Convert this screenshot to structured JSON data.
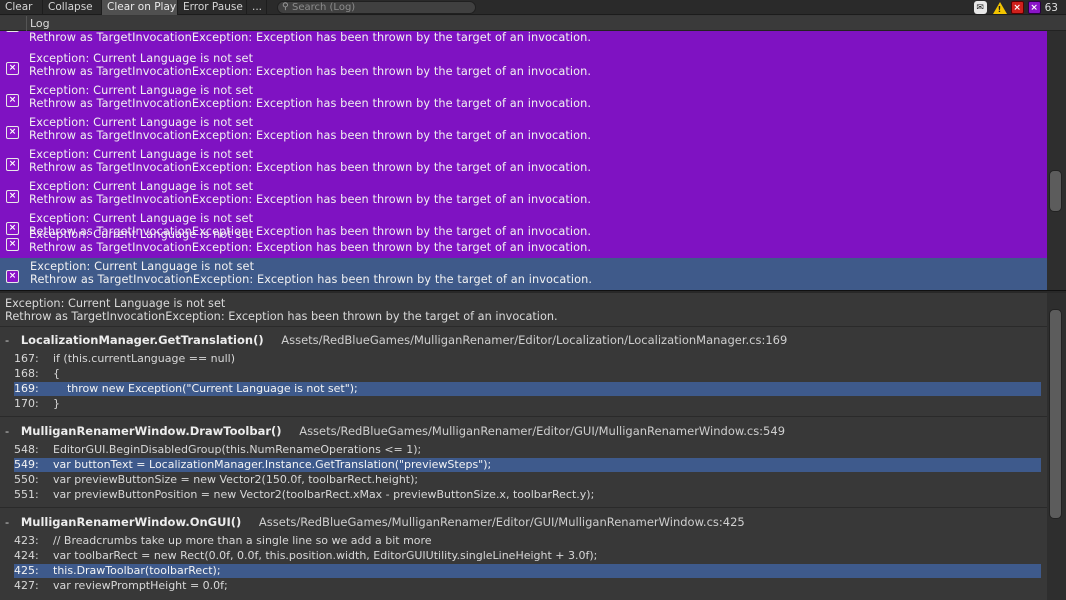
{
  "toolbar": {
    "buttons": [
      "Clear",
      "Collapse",
      "Clear on Play",
      "Error Pause",
      "..."
    ],
    "search_placeholder": "Search (Log)",
    "counts": {
      "exceptions": "63"
    }
  },
  "log_header": "Log",
  "log_entries": [
    {
      "line1": "",
      "line2": "Rethrow as TargetInvocationException: Exception has been thrown by the target of an invocation."
    },
    {
      "line1": "Exception: Current Language is not set",
      "line2": "Rethrow as TargetInvocationException: Exception has been thrown by the target of an invocation."
    },
    {
      "line1": "Exception: Current Language is not set",
      "line2": "Rethrow as TargetInvocationException: Exception has been thrown by the target of an invocation."
    },
    {
      "line1": "Exception: Current Language is not set",
      "line2": "Rethrow as TargetInvocationException: Exception has been thrown by the target of an invocation."
    },
    {
      "line1": "Exception: Current Language is not set",
      "line2": "Rethrow as TargetInvocationException: Exception has been thrown by the target of an invocation."
    },
    {
      "line1": "Exception: Current Language is not set",
      "line2": "Rethrow as TargetInvocationException: Exception has been thrown by the target of an invocation."
    },
    {
      "line1": "Exception: Current Language is not set",
      "line2": "Rethrow as TargetInvocationException: Exception has been thrown by the target of an invocation."
    },
    {
      "line1": "Exception: Current Language is not set",
      "line2": "Rethrow as TargetInvocationException: Exception has been thrown by the target of an invocation."
    },
    {
      "line1": "Exception: Current Language is not set",
      "line2": "Rethrow as TargetInvocationException: Exception has been thrown by the target of an invocation."
    }
  ],
  "detail": {
    "message1": "Exception: Current Language is not set",
    "message2": "Rethrow as TargetInvocationException: Exception has been thrown by the target of an invocation.",
    "frames": [
      {
        "dash": "-",
        "fn": "LocalizationManager.GetTranslation()",
        "path": "Assets/RedBlueGames/MulliganRenamer/Editor/Localization/LocalizationManager.cs:169",
        "lines": [
          {
            "num": "167:",
            "code": "if (this.currentLanguage == null)"
          },
          {
            "num": "168:",
            "code": "{"
          },
          {
            "num": "169:",
            "code": "    throw new Exception(\"Current Language is not set\");"
          },
          {
            "num": "170:",
            "code": "}"
          }
        ]
      },
      {
        "dash": "-",
        "fn": "MulliganRenamerWindow.DrawToolbar()",
        "path": "Assets/RedBlueGames/MulliganRenamer/Editor/GUI/MulliganRenamerWindow.cs:549",
        "lines": [
          {
            "num": "548:",
            "code": "EditorGUI.BeginDisabledGroup(this.NumRenameOperations <= 1);"
          },
          {
            "num": "549:",
            "code": "var buttonText = LocalizationManager.Instance.GetTranslation(\"previewSteps\");"
          },
          {
            "num": "550:",
            "code": "var previewButtonSize = new Vector2(150.0f, toolbarRect.height);"
          },
          {
            "num": "551:",
            "code": "var previewButtonPosition = new Vector2(toolbarRect.xMax - previewButtonSize.x, toolbarRect.y);"
          }
        ]
      },
      {
        "dash": "-",
        "fn": "MulliganRenamerWindow.OnGUI()",
        "path": "Assets/RedBlueGames/MulliganRenamer/Editor/GUI/MulliganRenamerWindow.cs:425",
        "lines": [
          {
            "num": "423:",
            "code": "// Breadcrumbs take up more than a single line so we add a bit more"
          },
          {
            "num": "424:",
            "code": "var toolbarRect = new Rect(0.0f, 0.0f, this.position.width, EditorGUIUtility.singleLineHeight + 3.0f);"
          },
          {
            "num": "425:",
            "code": "this.DrawToolbar(toolbarRect);"
          },
          {
            "num": "427:",
            "code": "var reviewPromptHeight = 0.0f;"
          }
        ]
      }
    ]
  },
  "colors": {
    "exception_row_bg": "#7f12c2",
    "selected_row_bg": "#3f5a8a",
    "highlight_line_bg": "#3e5a8c"
  }
}
